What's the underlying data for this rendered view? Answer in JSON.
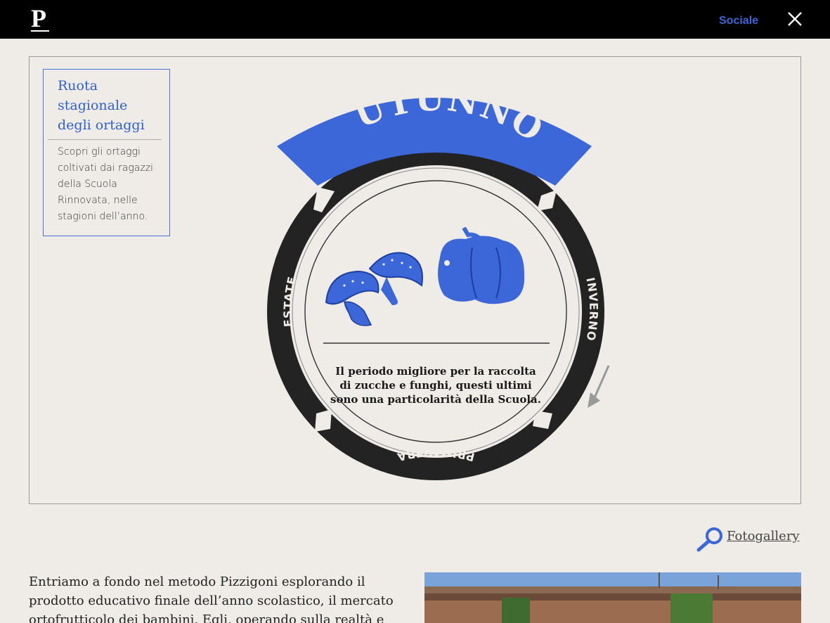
{
  "header": {
    "logo": "P",
    "social_label": "Sociale"
  },
  "legend": {
    "title": "Ruota stagionale degli ortaggi",
    "description": "Scopri gli ortaggi coltivati dai ragazzi della Scuola Rinnovata, nelle stagioni dell’anno."
  },
  "wheel": {
    "active_season": "AUTUNNO",
    "seasons": {
      "left": "ESTATE",
      "right": "INVERNO",
      "bottom": "PRIMAVERA"
    },
    "caption": "Il periodo migliore per la raccolta di zucche e funghi, questi ultimi sono una particolarità della Scuola."
  },
  "gallery": {
    "label": "Fotogallery"
  },
  "article": {
    "paragraph": "Entriamo a fondo nel metodo Pizzigoni esplorando il prodotto educativo finale dell’anno scolastico, il mercato ortofrutticolo dei bambini. Egli, operando sulla realtà e sulle problematiche"
  },
  "colors": {
    "accent": "#3b67d8",
    "wheel_ring": "#232323",
    "background": "#efebe6"
  },
  "icons": [
    "close-icon",
    "mushrooms-icon",
    "pepper-icon",
    "magnifier-icon",
    "arrow-icon"
  ]
}
